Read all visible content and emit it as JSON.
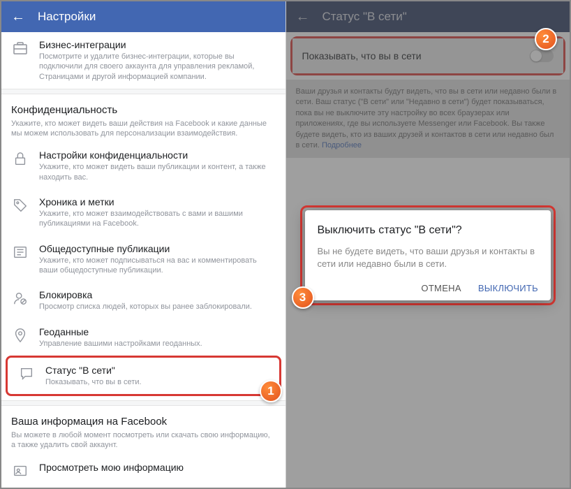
{
  "left": {
    "header": "Настройки",
    "biz": {
      "title": "Бизнес-интеграции",
      "desc": "Посмотрите и удалите бизнес-интеграции, которые вы подключили для своего аккаунта для управления рекламой, Страницами и другой информацией компании."
    },
    "privacy": {
      "title": "Конфиденциальность",
      "desc": "Укажите, кто может видеть ваши действия на Facebook и какие данные мы можем использовать для персонализации взаимодействия."
    },
    "items": [
      {
        "title": "Настройки конфиденциальности",
        "desc": "Укажите, кто может видеть ваши публикации и контент, а также находить вас."
      },
      {
        "title": "Хроника и метки",
        "desc": "Укажите, кто может взаимодействовать с вами и вашими публикациями на Facebook."
      },
      {
        "title": "Общедоступные публикации",
        "desc": "Укажите, кто может подписываться на вас и комментировать ваши общедоступные публикации."
      },
      {
        "title": "Блокировка",
        "desc": "Просмотр списка людей, которых вы ранее заблокировали."
      },
      {
        "title": "Геоданные",
        "desc": "Управление вашими настройками геоданных."
      },
      {
        "title": "Статус \"В сети\"",
        "desc": "Показывать, что вы в сети."
      }
    ],
    "info": {
      "title": "Ваша информация на Facebook",
      "desc": "Вы можете в любой момент посмотреть или скачать свою информацию, а также удалить свой аккаунт."
    },
    "viewinfo": "Просмотреть мою информацию"
  },
  "right": {
    "header": "Статус \"В сети\"",
    "toggle": "Показывать, что вы в сети",
    "info": "Ваши друзья и контакты будут видеть, что вы в сети или недавно были в сети. Ваш статус (\"В сети\" или \"Недавно в сети\") будет показываться, пока вы не выключите эту настройку во всех браузерах или приложениях, где вы используете Messenger или Facebook. Вы также будете видеть, кто из ваших друзей и контактов в сети или недавно был в сети.",
    "more": "Подробнее",
    "dialog": {
      "title": "Выключить статус \"В сети\"?",
      "body": "Вы не будете видеть, что ваши друзья и контакты в сети или недавно были в сети.",
      "cancel": "ОТМЕНА",
      "confirm": "ВЫКЛЮЧИТЬ"
    }
  },
  "badges": {
    "b1": "1",
    "b2": "2",
    "b3": "3"
  }
}
